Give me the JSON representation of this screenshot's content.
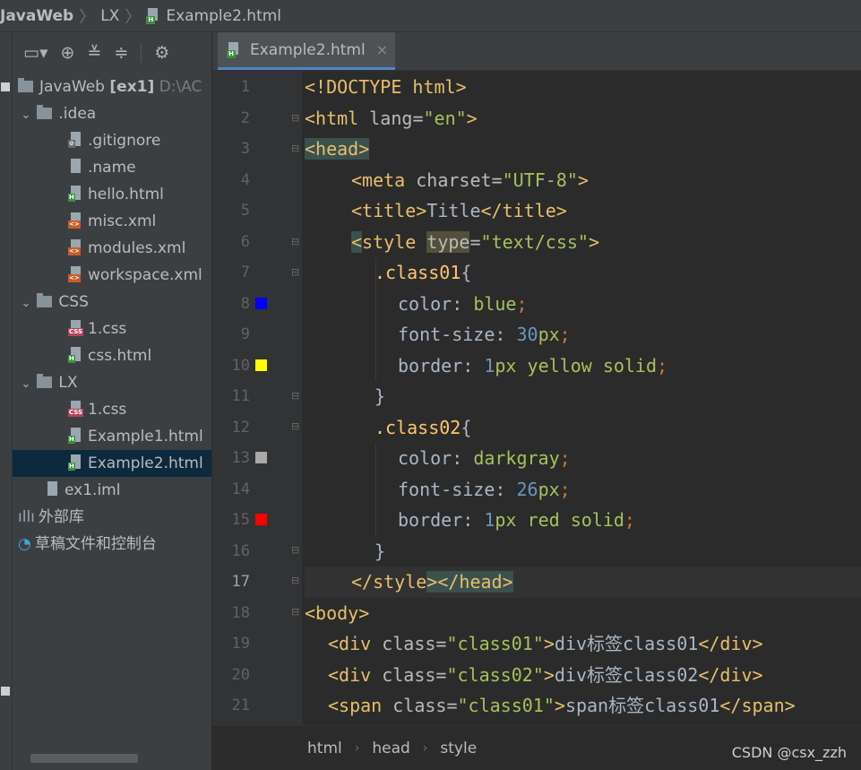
{
  "navbar": {
    "project": "JavaWeb",
    "folder": "LX",
    "file": "Example2.html"
  },
  "project_tree": {
    "items": [
      {
        "label": "JavaWeb",
        "suffix": "[ex1]",
        "path": "D:\\AC",
        "kind": "module"
      },
      {
        "label": ".idea",
        "kind": "folder"
      },
      {
        "label": ".gitignore",
        "kind": "gitignore"
      },
      {
        "label": ".name",
        "kind": "text"
      },
      {
        "label": "hello.html",
        "kind": "html"
      },
      {
        "label": "misc.xml",
        "kind": "xml"
      },
      {
        "label": "modules.xml",
        "kind": "xml"
      },
      {
        "label": "workspace.xml",
        "kind": "xml"
      },
      {
        "label": "CSS",
        "kind": "folder"
      },
      {
        "label": "1.css",
        "kind": "css"
      },
      {
        "label": "css.html",
        "kind": "html"
      },
      {
        "label": "LX",
        "kind": "folder"
      },
      {
        "label": "1.css",
        "kind": "css"
      },
      {
        "label": "Example1.html",
        "kind": "html"
      },
      {
        "label": "Example2.html",
        "kind": "html",
        "selected": true
      },
      {
        "label": "ex1.iml",
        "kind": "iml"
      },
      {
        "label": "外部库",
        "kind": "library"
      },
      {
        "label": "草稿文件和控制台",
        "kind": "scratch"
      }
    ]
  },
  "editor": {
    "tab_label": "Example2.html",
    "tab_close": "×",
    "current_line": 17,
    "line_numbers": [
      "1",
      "2",
      "3",
      "4",
      "5",
      "6",
      "7",
      "8",
      "9",
      "10",
      "11",
      "12",
      "13",
      "14",
      "15",
      "16",
      "17",
      "18",
      "19",
      "20",
      "21"
    ],
    "color_swatches": {
      "8": "#0000ff",
      "10": "#ffff00",
      "13": "#a9a9a9",
      "15": "#ff0000"
    },
    "code": {
      "l1": {
        "a": "<!DOCTYPE",
        "b": " html",
        "c": ">"
      },
      "l2": {
        "a": "<html",
        "b": " lang",
        "c": "=",
        "d": "\"en\"",
        "e": ">"
      },
      "l3": "<head>",
      "l4": {
        "a": "<meta",
        "b": " charset",
        "c": "=",
        "d": "\"UTF-8\"",
        "e": ">"
      },
      "l5": {
        "a": "<title>",
        "b": "Title",
        "c": "</title>"
      },
      "l6": {
        "a": "<",
        "b": "style",
        "c": "type",
        "d": "=",
        "e": "\"text/css\"",
        "f": ">"
      },
      "l7": {
        "a": ".class01",
        "b": "{"
      },
      "l8": {
        "prop": "color",
        "colon": ": ",
        "val": "blue",
        "semi": ";"
      },
      "l9": {
        "prop": "font-size",
        "colon": ": ",
        "num": "30",
        "unit": "px",
        "semi": ";"
      },
      "l10": {
        "prop": "border",
        "colon": ": ",
        "num": "1",
        "unit": "px",
        "val": " yellow solid",
        "semi": ";"
      },
      "l11": "}",
      "l12": {
        "a": ".class02",
        "b": "{"
      },
      "l13": {
        "prop": "color",
        "colon": ": ",
        "val": "darkgray",
        "semi": ";"
      },
      "l14": {
        "prop": "font-size",
        "colon": ": ",
        "num": "26",
        "unit": "px",
        "semi": ";"
      },
      "l15": {
        "prop": "border",
        "colon": ": ",
        "num": "1",
        "unit": "px",
        "val": " red solid",
        "semi": ";"
      },
      "l16": "}",
      "l17": {
        "a": "</style",
        "b": ">",
        "c": "</head>"
      },
      "l18": "<body>",
      "l19": {
        "a": "<div",
        "b": " class",
        "c": "=",
        "d": "\"class01\"",
        "e": ">",
        "f": "div标签class01",
        "g": "</div>"
      },
      "l20": {
        "a": "<div",
        "b": " class",
        "c": "=",
        "d": "\"class02\"",
        "e": ">",
        "f": "div标签class02",
        "g": "</div>"
      },
      "l21": {
        "a": "<span",
        "b": " class",
        "c": "=",
        "d": "\"class01\"",
        "e": ">",
        "f": "span标签class01",
        "g": "</span>"
      }
    }
  },
  "breadcrumb": {
    "items": [
      "html",
      "head",
      "style"
    ]
  },
  "watermark": "CSDN @csx_zzh"
}
